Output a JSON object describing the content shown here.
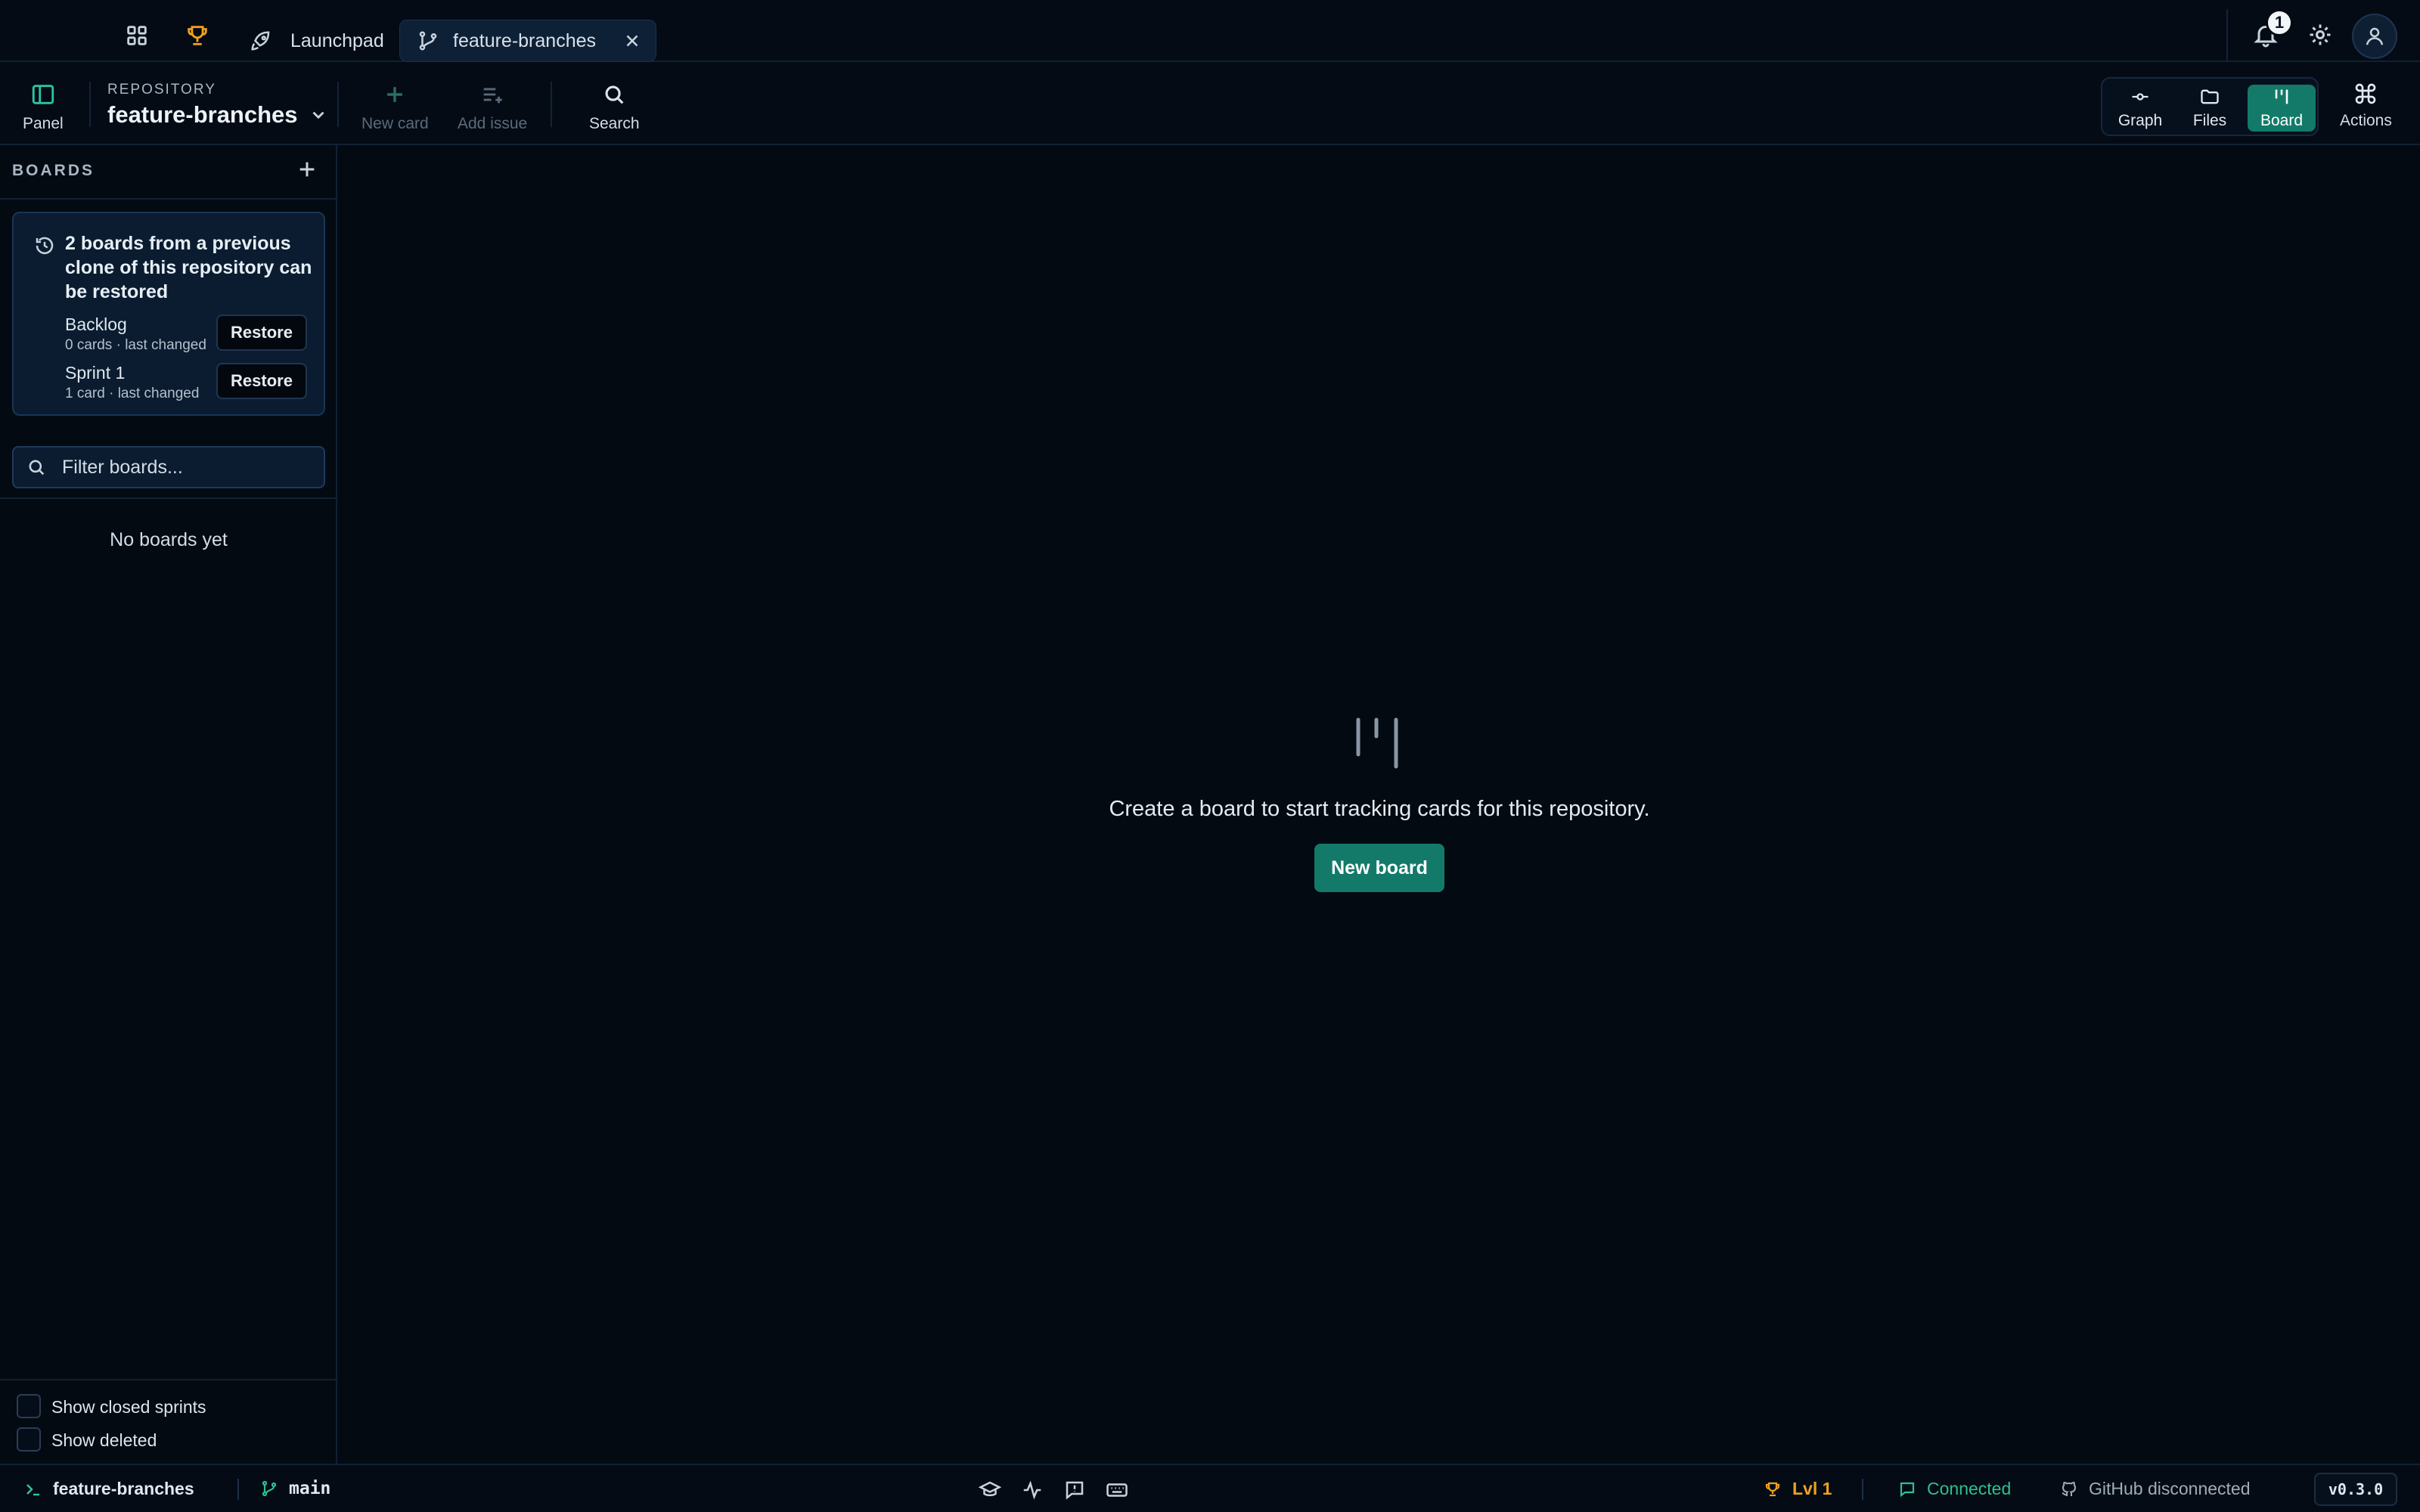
{
  "tabs": {
    "launchpad_label": "Launchpad",
    "active_label": "feature-branches"
  },
  "header": {
    "notification_count": "1"
  },
  "toolbar": {
    "panel_label": "Panel",
    "repo_caption": "REPOSITORY",
    "repo_name": "feature-branches",
    "new_card_label": "New card",
    "add_issue_label": "Add issue",
    "search_label": "Search",
    "views": {
      "graph": "Graph",
      "files": "Files",
      "board": "Board",
      "actions": "Actions"
    },
    "active_view": "Board"
  },
  "sidebar": {
    "header": "BOARDS",
    "restore": {
      "message": "2 boards from a previous clone of this repository can be restored",
      "button_label": "Restore",
      "boards": [
        {
          "name": "Backlog",
          "meta": "0 cards · last changed"
        },
        {
          "name": "Sprint 1",
          "meta": "1 card · last changed"
        }
      ]
    },
    "filter_placeholder": "Filter boards...",
    "empty_text": "No boards yet",
    "options": {
      "show_closed_sprints": "Show closed sprints",
      "show_deleted": "Show deleted"
    }
  },
  "main": {
    "empty_message": "Create a board to start tracking cards for this repository.",
    "new_board_label": "New board"
  },
  "statusbar": {
    "repo": "feature-branches",
    "branch": "main",
    "level": "Lvl 1",
    "connection": "Connected",
    "github": "GitHub disconnected",
    "version": "v0.3.0"
  },
  "colors": {
    "accent": "#137a6a",
    "background": "#030a12",
    "connected": "#2fbf8f",
    "level": "#f0a020"
  }
}
